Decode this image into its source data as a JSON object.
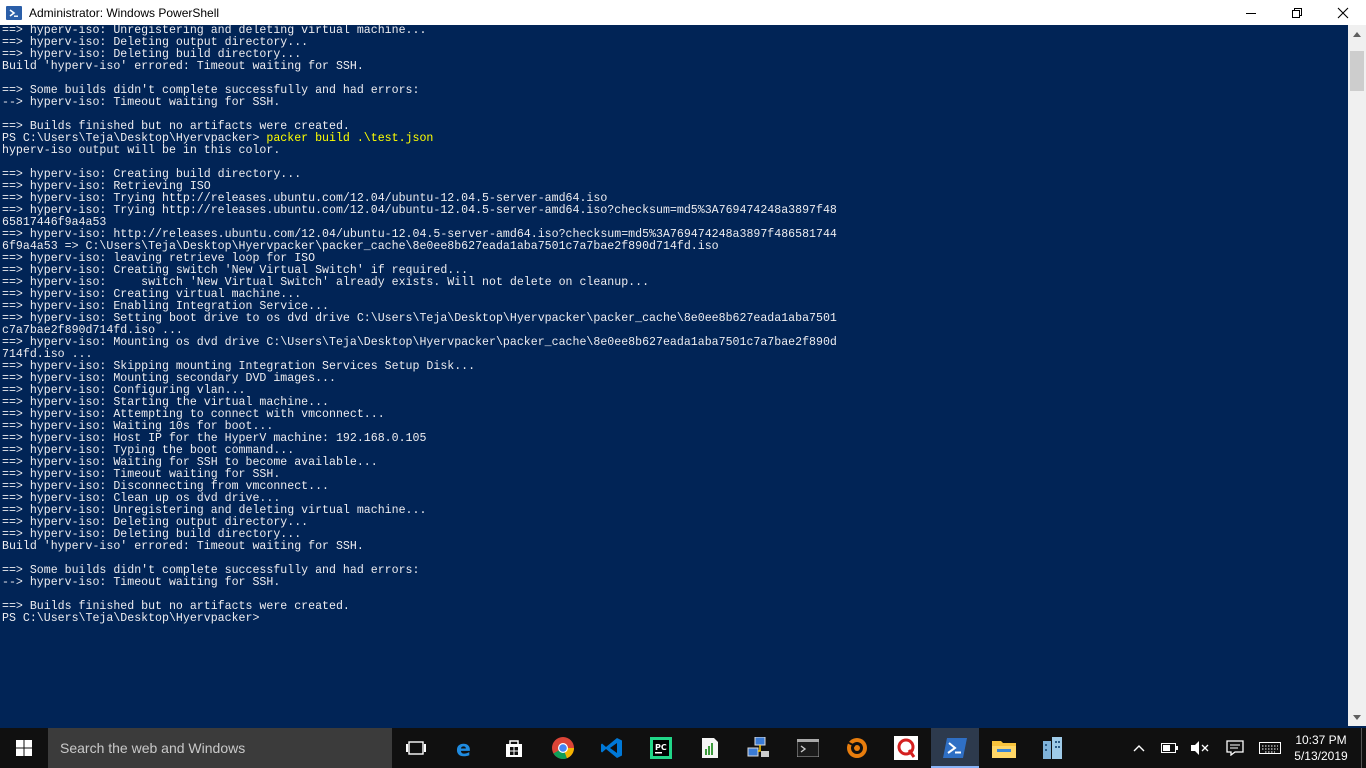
{
  "window": {
    "title": "Administrator: Windows PowerShell",
    "controls": {
      "minimize": "—",
      "restore": "❐",
      "close": "✕"
    }
  },
  "console": {
    "lines": [
      "==> hyperv-iso: Unregistering and deleting virtual machine...",
      "==> hyperv-iso: Deleting output directory...",
      "==> hyperv-iso: Deleting build directory...",
      "Build 'hyperv-iso' errored: Timeout waiting for SSH.",
      "",
      "==> Some builds didn't complete successfully and had errors:",
      "--> hyperv-iso: Timeout waiting for SSH.",
      "",
      "==> Builds finished but no artifacts were created.",
      "PS C:\\Users\\Teja\\Desktop\\Hyervpacker> ",
      "hyperv-iso output will be in this color.",
      "",
      "==> hyperv-iso: Creating build directory...",
      "==> hyperv-iso: Retrieving ISO",
      "==> hyperv-iso: Trying http://releases.ubuntu.com/12.04/ubuntu-12.04.5-server-amd64.iso",
      "==> hyperv-iso: Trying http://releases.ubuntu.com/12.04/ubuntu-12.04.5-server-amd64.iso?checksum=md5%3A769474248a3897f48",
      "65817446f9a4a53",
      "==> hyperv-iso: http://releases.ubuntu.com/12.04/ubuntu-12.04.5-server-amd64.iso?checksum=md5%3A769474248a3897f486581744",
      "6f9a4a53 => C:\\Users\\Teja\\Desktop\\Hyervpacker\\packer_cache\\8e0ee8b627eada1aba7501c7a7bae2f890d714fd.iso",
      "==> hyperv-iso: leaving retrieve loop for ISO",
      "==> hyperv-iso: Creating switch 'New Virtual Switch' if required...",
      "==> hyperv-iso:     switch 'New Virtual Switch' already exists. Will not delete on cleanup...",
      "==> hyperv-iso: Creating virtual machine...",
      "==> hyperv-iso: Enabling Integration Service...",
      "==> hyperv-iso: Setting boot drive to os dvd drive C:\\Users\\Teja\\Desktop\\Hyervpacker\\packer_cache\\8e0ee8b627eada1aba7501",
      "c7a7bae2f890d714fd.iso ...",
      "==> hyperv-iso: Mounting os dvd drive C:\\Users\\Teja\\Desktop\\Hyervpacker\\packer_cache\\8e0ee8b627eada1aba7501c7a7bae2f890d",
      "714fd.iso ...",
      "==> hyperv-iso: Skipping mounting Integration Services Setup Disk...",
      "==> hyperv-iso: Mounting secondary DVD images...",
      "==> hyperv-iso: Configuring vlan...",
      "==> hyperv-iso: Starting the virtual machine...",
      "==> hyperv-iso: Attempting to connect with vmconnect...",
      "==> hyperv-iso: Waiting 10s for boot...",
      "==> hyperv-iso: Host IP for the HyperV machine: 192.168.0.105",
      "==> hyperv-iso: Typing the boot command...",
      "==> hyperv-iso: Waiting for SSH to become available...",
      "==> hyperv-iso: Timeout waiting for SSH.",
      "==> hyperv-iso: Disconnecting from vmconnect...",
      "==> hyperv-iso: Clean up os dvd drive...",
      "==> hyperv-iso: Unregistering and deleting virtual machine...",
      "==> hyperv-iso: Deleting output directory...",
      "==> hyperv-iso: Deleting build directory...",
      "Build 'hyperv-iso' errored: Timeout waiting for SSH.",
      "",
      "==> Some builds didn't complete successfully and had errors:",
      "--> hyperv-iso: Timeout waiting for SSH.",
      "",
      "==> Builds finished but no artifacts were created.",
      "PS C:\\Users\\Teja\\Desktop\\Hyervpacker>"
    ],
    "command": {
      "line_index": 9,
      "text": "packer build .\\test.json"
    },
    "text_color": "#eeedf0",
    "background_color": "#012456",
    "command_color": "#ffff00"
  },
  "taskbar": {
    "search_placeholder": "Search the web and Windows",
    "apps": [
      "task-view-icon",
      "edge-icon",
      "store-icon",
      "chrome-icon",
      "vscode-icon",
      "pycharm-icon",
      "spreadsheet-icon",
      "network-icon",
      "terminal-icon",
      "blender-icon",
      "qlik-icon",
      "powershell-icon",
      "file-explorer-icon",
      "building-icon"
    ],
    "active_app": "powershell-icon",
    "clock": {
      "time": "10:37 PM",
      "date": "5/13/2019"
    }
  }
}
